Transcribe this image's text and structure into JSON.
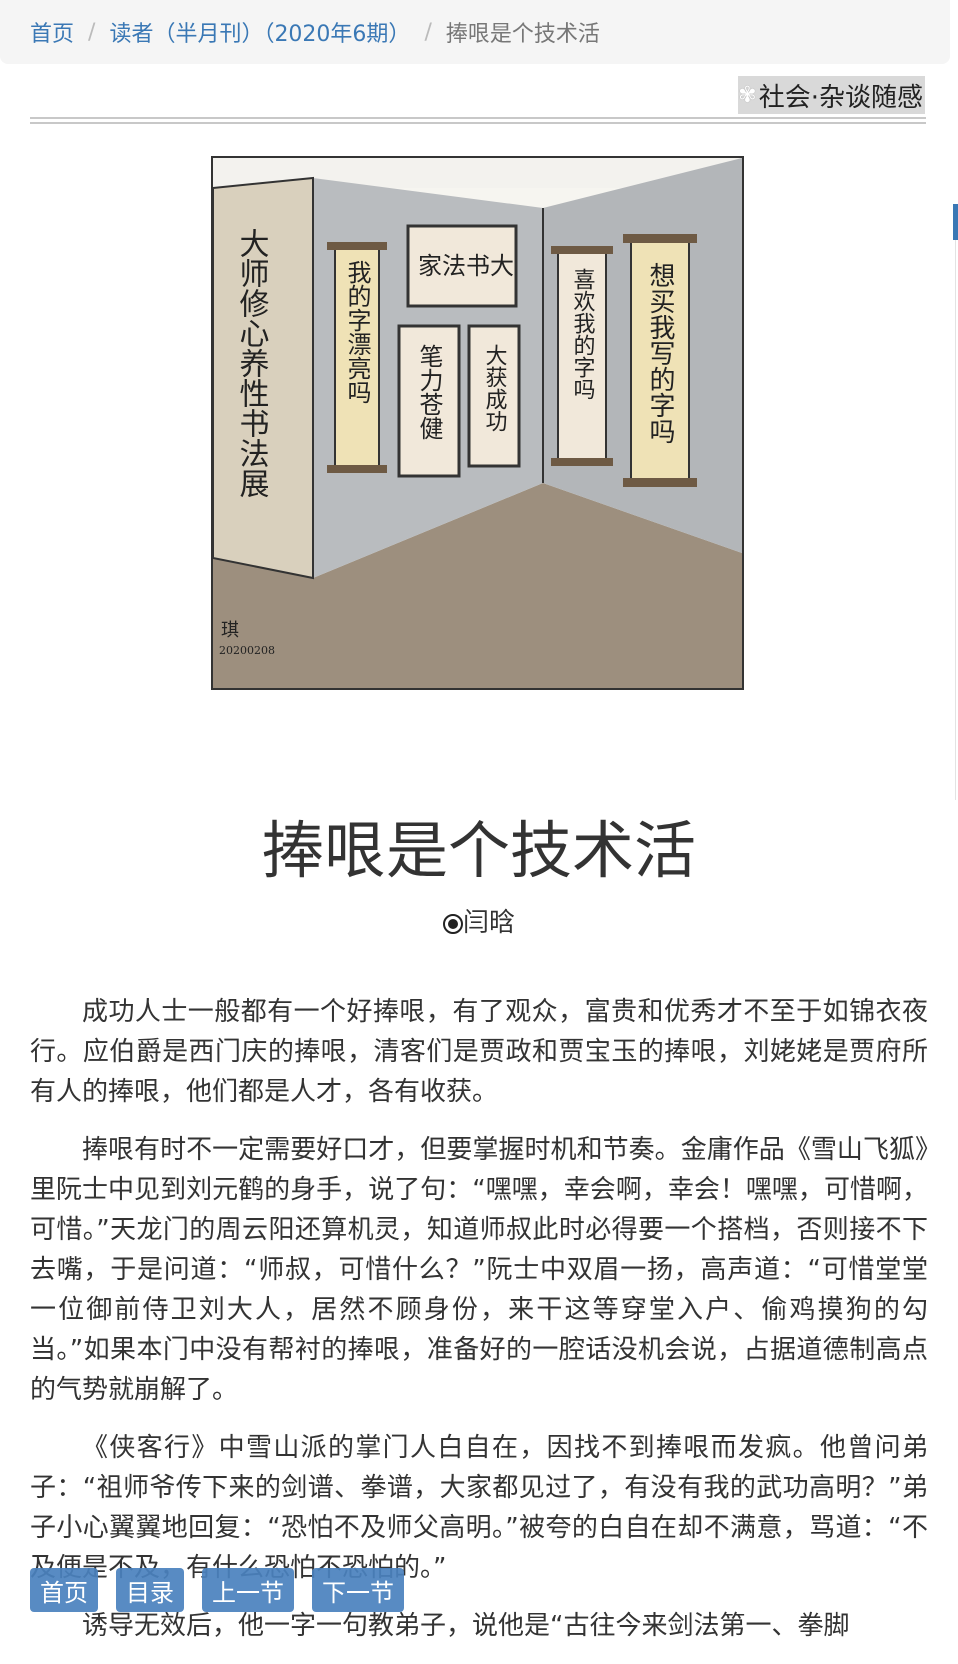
{
  "breadcrumb": {
    "home": "首页",
    "issue": "读者（半月刊）（2020年6期）",
    "current": "捧哏是个技术活"
  },
  "category": {
    "icon": "flower-icon",
    "label": "社会·杂谈随感"
  },
  "cartoon": {
    "wall_sign": "大师修心养性书法展",
    "scrolls": [
      "我的字漂亮吗",
      "家法书大",
      "笔力苍健",
      "大获成功",
      "喜欢我的字吗",
      "想买我写的字吗"
    ],
    "signature": "琪",
    "date": "20200208"
  },
  "article": {
    "title": "捧哏是个技术活",
    "author": "闫晗",
    "paragraphs": [
      "成功人士一般都有一个好捧哏，有了观众，富贵和优秀才不至于如锦衣夜行。应伯爵是西门庆的捧哏，清客们是贾政和贾宝玉的捧哏，刘姥姥是贾府所有人的捧哏，他们都是人才，各有收获。",
      "捧哏有时不一定需要好口才，但要掌握时机和节奏。金庸作品《雪山飞狐》里阮士中见到刘元鹤的身手，说了句：“嘿嘿，幸会啊，幸会！嘿嘿，可惜啊，可惜。”天龙门的周云阳还算机灵，知道师叔此时必得要一个搭档，否则接不下去嘴，于是问道：“师叔，可惜什么？”阮士中双眉一扬，高声道：“可惜堂堂一位御前侍卫刘大人，居然不顾身份，来干这等穿堂入户、偷鸡摸狗的勾当。”如果本门中没有帮衬的捧哏，准备好的一腔话没机会说，占据道德制高点的气势就崩解了。",
      "《侠客行》中雪山派的掌门人白自在，因找不到捧哏而发疯。他曾问弟子：“祖师爷传下来的剑谱、拳谱，大家都见过了，有没有我的武功高明？”弟子小心翼翼地回复：“恐怕不及师父高明。”被夸的白自在却不满意，骂道：“不及便是不及，有什么恐怕不恐怕的。”",
      "诱导无效后，他一字一句教弟子，说他是“古往今来剑法第一、拳脚"
    ]
  },
  "bottom_nav": {
    "home": "首页",
    "toc": "目录",
    "prev": "上一节",
    "next": "下一节"
  }
}
